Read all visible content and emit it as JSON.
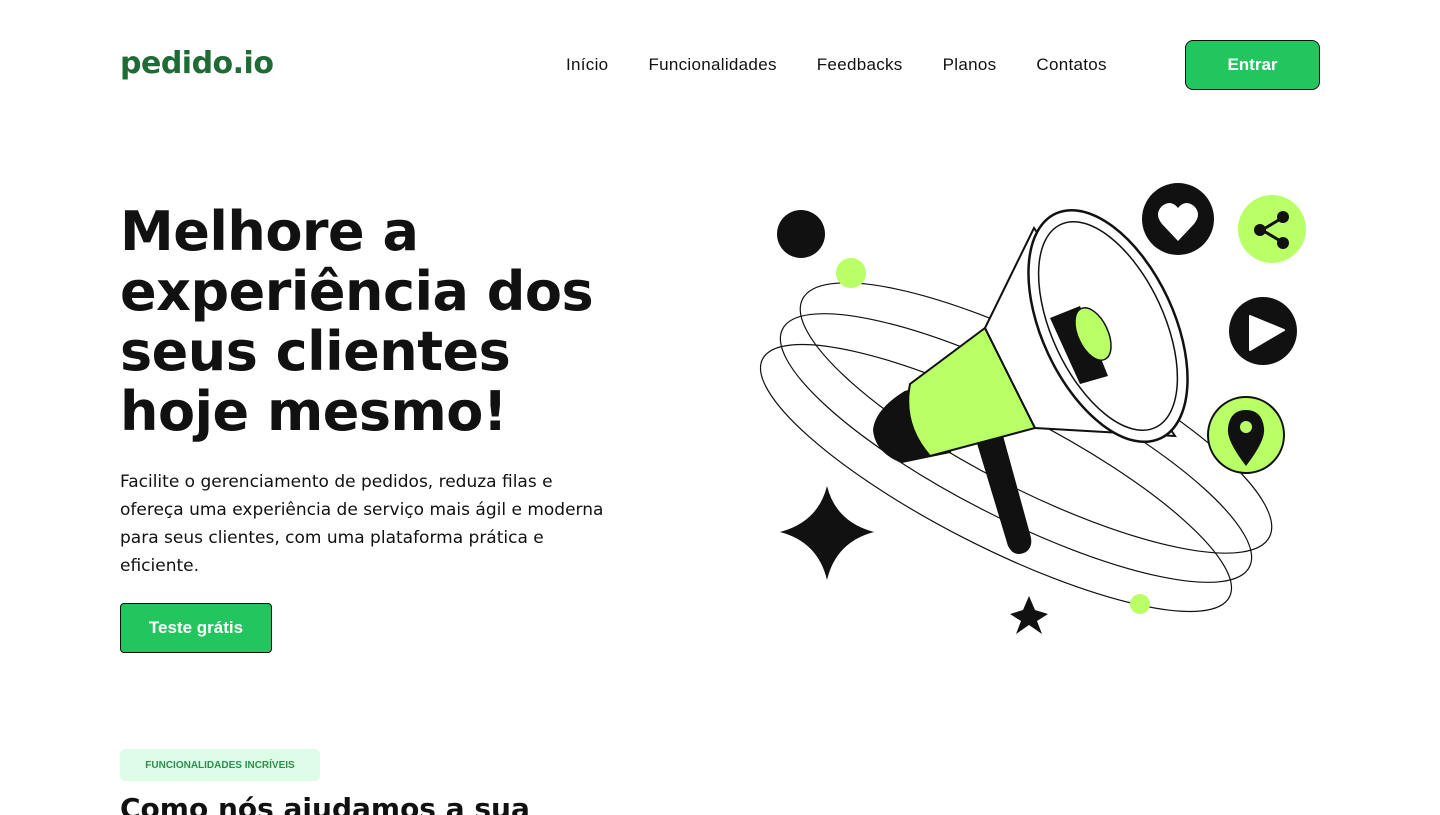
{
  "brand": {
    "logo": "pedido.io"
  },
  "nav": {
    "items": [
      "Início",
      "Funcionalidades",
      "Feedbacks",
      "Planos",
      "Contatos"
    ],
    "login_label": "Entrar"
  },
  "hero": {
    "title": "Melhore a experiência dos seus clientes hoje mesmo!",
    "description": "Facilite o gerenciamento de pedidos, reduza filas e ofereça uma experiência de serviço mais ágil e moderna para seus clientes, com uma plataforma prática e eficiente.",
    "cta_label": "Teste grátis"
  },
  "features": {
    "badge": "FUNCIONALIDADES INCRÍVEIS",
    "title": "Como nós ajudamos a sua"
  },
  "illustration": {
    "icons": [
      "megaphone-icon",
      "heart-icon",
      "share-icon",
      "play-icon",
      "location-pin-icon",
      "sparkle-star-icon"
    ]
  },
  "colors": {
    "brand_green": "#22c55e",
    "logo_green": "#1f6b36",
    "lime_accent": "#b9ff66",
    "badge_bg": "#dcfce7"
  }
}
